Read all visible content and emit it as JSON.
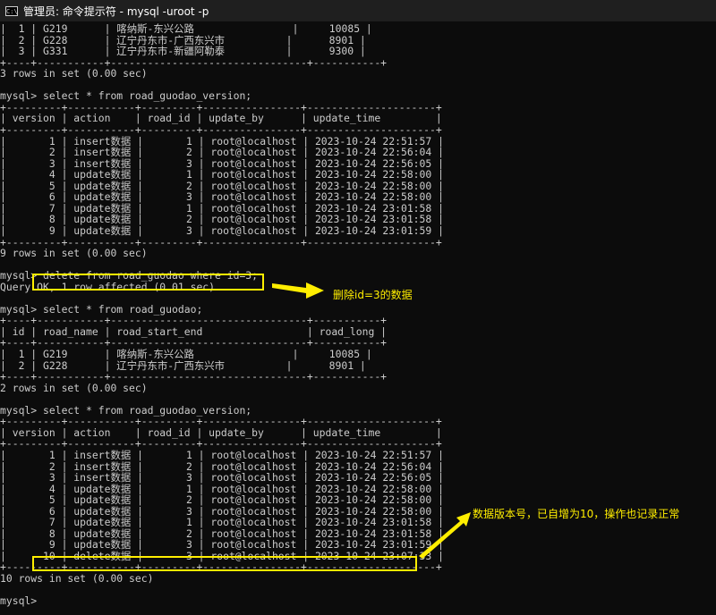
{
  "window": {
    "title": "管理员: 命令提示符 - mysql  -uroot -p",
    "icon": "cmd-icon"
  },
  "terminal_lines": [
    "|  1 | G219      | 喀纳斯-东兴公路                |     10085 |",
    "|  2 | G228      | 辽宁丹东市-广西东兴市          |      8901 |",
    "|  3 | G331      | 辽宁丹东市-新疆阿勒泰          |      9300 |",
    "+----+-----------+--------------------------------+-----------+",
    "3 rows in set (0.00 sec)",
    "",
    "mysql> select * from road_guodao_version;",
    "+---------+-----------+---------+----------------+---------------------+",
    "| version | action    | road_id | update_by      | update_time         |",
    "+---------+-----------+---------+----------------+---------------------+",
    "|       1 | insert数据 |       1 | root@localhost | 2023-10-24 22:51:57 |",
    "|       2 | insert数据 |       2 | root@localhost | 2023-10-24 22:56:04 |",
    "|       3 | insert数据 |       3 | root@localhost | 2023-10-24 22:56:05 |",
    "|       4 | update数据 |       1 | root@localhost | 2023-10-24 22:58:00 |",
    "|       5 | update数据 |       2 | root@localhost | 2023-10-24 22:58:00 |",
    "|       6 | update数据 |       3 | root@localhost | 2023-10-24 22:58:00 |",
    "|       7 | update数据 |       1 | root@localhost | 2023-10-24 23:01:58 |",
    "|       8 | update数据 |       2 | root@localhost | 2023-10-24 23:01:58 |",
    "|       9 | update数据 |       3 | root@localhost | 2023-10-24 23:01:59 |",
    "+---------+-----------+---------+----------------+---------------------+",
    "9 rows in set (0.00 sec)",
    "",
    "mysql> delete from road_guodao where id=3;",
    "Query OK, 1 row affected (0.01 sec)",
    "",
    "mysql> select * from road_guodao;",
    "+----+-----------+--------------------------------+-----------+",
    "| id | road_name | road_start_end                 | road_long |",
    "+----+-----------+--------------------------------+-----------+",
    "|  1 | G219      | 喀纳斯-东兴公路                |     10085 |",
    "|  2 | G228      | 辽宁丹东市-广西东兴市          |      8901 |",
    "+----+-----------+--------------------------------+-----------+",
    "2 rows in set (0.00 sec)",
    "",
    "mysql> select * from road_guodao_version;",
    "+---------+-----------+---------+----------------+---------------------+",
    "| version | action    | road_id | update_by      | update_time         |",
    "+---------+-----------+---------+----------------+---------------------+",
    "|       1 | insert数据 |       1 | root@localhost | 2023-10-24 22:51:57 |",
    "|       2 | insert数据 |       2 | root@localhost | 2023-10-24 22:56:04 |",
    "|       3 | insert数据 |       3 | root@localhost | 2023-10-24 22:56:05 |",
    "|       4 | update数据 |       1 | root@localhost | 2023-10-24 22:58:00 |",
    "|       5 | update数据 |       2 | root@localhost | 2023-10-24 22:58:00 |",
    "|       6 | update数据 |       3 | root@localhost | 2023-10-24 22:58:00 |",
    "|       7 | update数据 |       1 | root@localhost | 2023-10-24 23:01:58 |",
    "|       8 | update数据 |       2 | root@localhost | 2023-10-24 23:01:58 |",
    "|       9 | update数据 |       3 | root@localhost | 2023-10-24 23:01:59 |",
    "|      10 | delete数据 |       3 | root@localhost | 2023-10-24 23:07:33 |",
    "+---------+-----------+---------+----------------+---------------------+",
    "10 rows in set (0.00 sec)",
    "",
    "mysql>"
  ],
  "annotations": {
    "delete_note": "删除id=3的数据",
    "version_note": "数据版本号，已自增为10，操作也记录正常"
  },
  "colors": {
    "background": "#0c0c0c",
    "text": "#cccccc",
    "highlight": "#ffee00"
  }
}
